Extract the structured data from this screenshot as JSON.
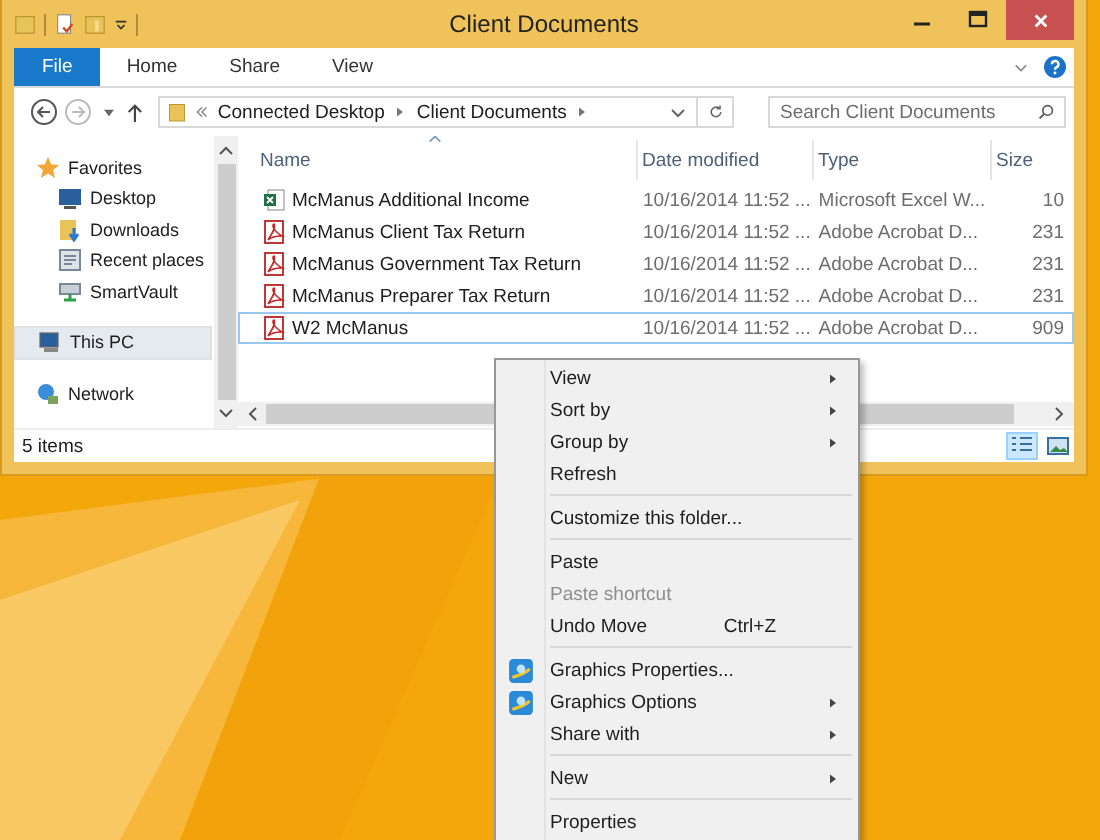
{
  "window": {
    "title": "Client Documents"
  },
  "ribbon": {
    "tabs": [
      {
        "label": "File",
        "kind": "file",
        "selected": false
      },
      {
        "label": "Home",
        "kind": "tab",
        "selected": false
      },
      {
        "label": "Share",
        "kind": "tab",
        "selected": false
      },
      {
        "label": "View",
        "kind": "tab",
        "selected": false
      }
    ]
  },
  "address_bar": {
    "breadcrumbs": [
      "Connected Desktop",
      "Client Documents"
    ]
  },
  "search": {
    "placeholder": "Search Client Documents"
  },
  "navigation": {
    "items": [
      {
        "label": "Favorites",
        "kind": "star",
        "selected": false,
        "children": [
          {
            "label": "Desktop",
            "kind": "desktop",
            "selected": false
          },
          {
            "label": "Downloads",
            "kind": "downloads",
            "selected": false
          },
          {
            "label": "Recent places",
            "kind": "recent",
            "selected": false
          },
          {
            "label": "SmartVault",
            "kind": "vault",
            "selected": false
          }
        ]
      },
      {
        "label": "This PC",
        "kind": "pc",
        "selected": true
      },
      {
        "label": "Network",
        "kind": "network",
        "selected": false
      }
    ]
  },
  "table": {
    "columns": [
      "Name",
      "Date modified",
      "Type",
      "Size"
    ],
    "rows": [
      {
        "kind": "excel",
        "name": "McManus Additional Income",
        "date": "10/16/2014 11:52 ...",
        "type": "Microsoft Excel W...",
        "size": "10",
        "selected": false
      },
      {
        "kind": "pdf",
        "name": "McManus Client Tax Return",
        "date": "10/16/2014 11:52 ...",
        "type": "Adobe Acrobat D...",
        "size": "231",
        "selected": false
      },
      {
        "kind": "pdf",
        "name": "McManus Government Tax Return",
        "date": "10/16/2014 11:52 ...",
        "type": "Adobe Acrobat D...",
        "size": "231",
        "selected": false
      },
      {
        "kind": "pdf",
        "name": "McManus Preparer Tax Return",
        "date": "10/16/2014 11:52 ...",
        "type": "Adobe Acrobat D...",
        "size": "231",
        "selected": false
      },
      {
        "kind": "pdf",
        "name": "W2 McManus",
        "date": "10/16/2014 11:52 ...",
        "type": "Adobe Acrobat D...",
        "size": "909",
        "selected": true
      }
    ]
  },
  "status_bar": {
    "text": "5 items",
    "views": [
      {
        "kind": "details",
        "selected": true
      },
      {
        "kind": "large",
        "selected": false
      }
    ]
  },
  "context_menu": {
    "items": [
      {
        "kind": "item",
        "label": "View",
        "submenu": true,
        "disabled": false,
        "icon": false
      },
      {
        "kind": "item",
        "label": "Sort by",
        "submenu": true,
        "disabled": false,
        "icon": false
      },
      {
        "kind": "item",
        "label": "Group by",
        "submenu": true,
        "disabled": false,
        "icon": false
      },
      {
        "kind": "item",
        "label": "Refresh",
        "submenu": false,
        "disabled": false,
        "icon": false
      },
      {
        "kind": "separator"
      },
      {
        "kind": "item",
        "label": "Customize this folder...",
        "submenu": false,
        "disabled": false,
        "icon": false
      },
      {
        "kind": "separator"
      },
      {
        "kind": "item",
        "label": "Paste",
        "submenu": false,
        "disabled": false,
        "icon": false
      },
      {
        "kind": "item",
        "label": "Paste shortcut",
        "submenu": false,
        "disabled": true,
        "icon": false
      },
      {
        "kind": "item",
        "label": "Undo Move",
        "shortcut": "Ctrl+Z",
        "submenu": false,
        "disabled": false,
        "icon": false
      },
      {
        "kind": "separator"
      },
      {
        "kind": "item",
        "label": "Graphics Properties...",
        "submenu": false,
        "disabled": false,
        "icon": true
      },
      {
        "kind": "item",
        "label": "Graphics Options",
        "submenu": true,
        "disabled": false,
        "icon": true
      },
      {
        "kind": "item",
        "label": "Share with",
        "submenu": true,
        "disabled": false,
        "icon": false
      },
      {
        "kind": "separator"
      },
      {
        "kind": "item",
        "label": "New",
        "submenu": true,
        "disabled": false,
        "icon": false
      },
      {
        "kind": "separator"
      },
      {
        "kind": "item",
        "label": "Properties",
        "submenu": false,
        "disabled": false,
        "icon": false
      }
    ]
  }
}
